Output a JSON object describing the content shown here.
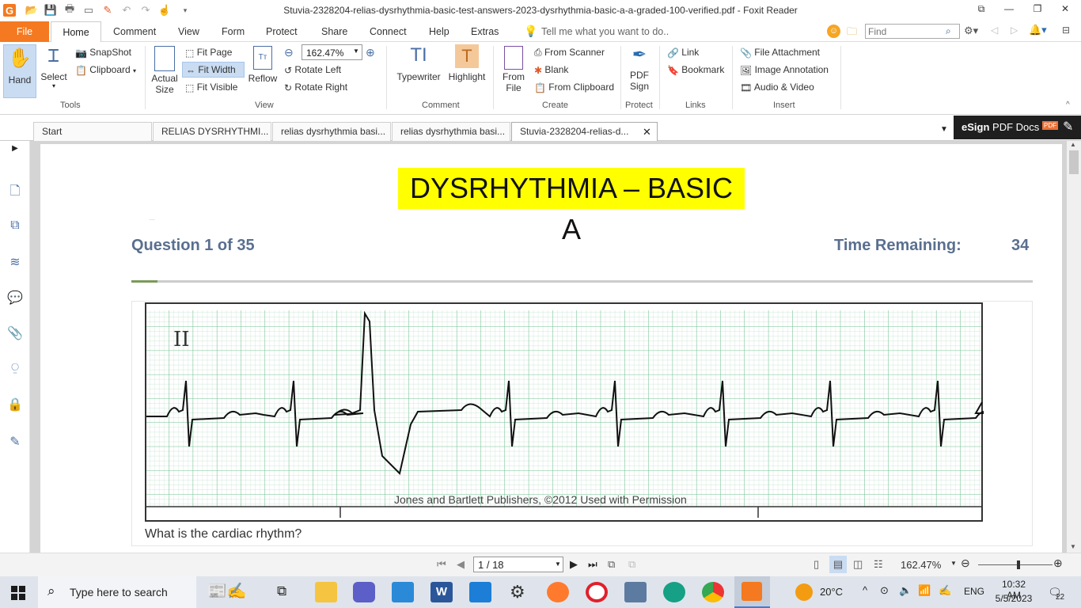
{
  "window": {
    "title": "Stuvia-2328204-relias-dysrhythmia-basic-test-answers-2023-dysrhythmia-basic-a-a-graded-100-verified.pdf - Foxit Reader"
  },
  "menu": {
    "file": "File",
    "home": "Home",
    "items": [
      "Comment",
      "View",
      "Form",
      "Protect",
      "Share",
      "Connect",
      "Help",
      "Extras"
    ],
    "tell_me": "Tell me what you want to do..",
    "find_placeholder": "Find"
  },
  "ribbon": {
    "tools": {
      "hand": "Hand",
      "select": "Select",
      "snapshot": "SnapShot",
      "clipboard": "Clipboard",
      "group": "Tools"
    },
    "view": {
      "actual_size_1": "Actual",
      "actual_size_2": "Size",
      "fit_page": "Fit Page",
      "fit_width": "Fit Width",
      "fit_visible": "Fit Visible",
      "reflow": "Reflow",
      "zoom": "162.47%",
      "rotate_left": "Rotate Left",
      "rotate_right": "Rotate Right",
      "group": "View"
    },
    "comment": {
      "typewriter": "Typewriter",
      "highlight": "Highlight",
      "group": "Comment"
    },
    "create": {
      "from_file_1": "From",
      "from_file_2": "File",
      "from_scanner": "From Scanner",
      "blank": "Blank",
      "from_clipboard": "From Clipboard",
      "group": "Create"
    },
    "protect": {
      "pdf_sign_1": "PDF",
      "pdf_sign_2": "Sign",
      "group": "Protect"
    },
    "links": {
      "link": "Link",
      "bookmark": "Bookmark",
      "group": "Links"
    },
    "insert": {
      "file_attachment": "File Attachment",
      "image_annotation": "Image Annotation",
      "audio_video": "Audio & Video",
      "group": "Insert"
    }
  },
  "tabs": [
    "Start",
    "RELIAS DYSRHYTHMI...",
    "relias dysrhythmia basi...",
    "relias dysrhythmia basi...",
    "Stuvia-2328204-relias-d..."
  ],
  "esign": {
    "bold": "eSign",
    "rest": " PDF Docs"
  },
  "document": {
    "heading": "DYSRHYTHMIA – BASIC A",
    "question": "Question 1 of 35",
    "time_label": "Time Remaining:",
    "time_value": "34",
    "lead": "II",
    "credit": "Jones and Bartlett Publishers, ©2012 Used with Permission",
    "prompt": "What is the cardiac rhythm?"
  },
  "status": {
    "page": "1 / 18",
    "zoom": "162.47%"
  },
  "taskbar": {
    "search": "Type here to search",
    "weather": "20°C",
    "lang": "ENG",
    "time": "10:32 AM",
    "date": "5/5/2023",
    "notif": "22"
  }
}
